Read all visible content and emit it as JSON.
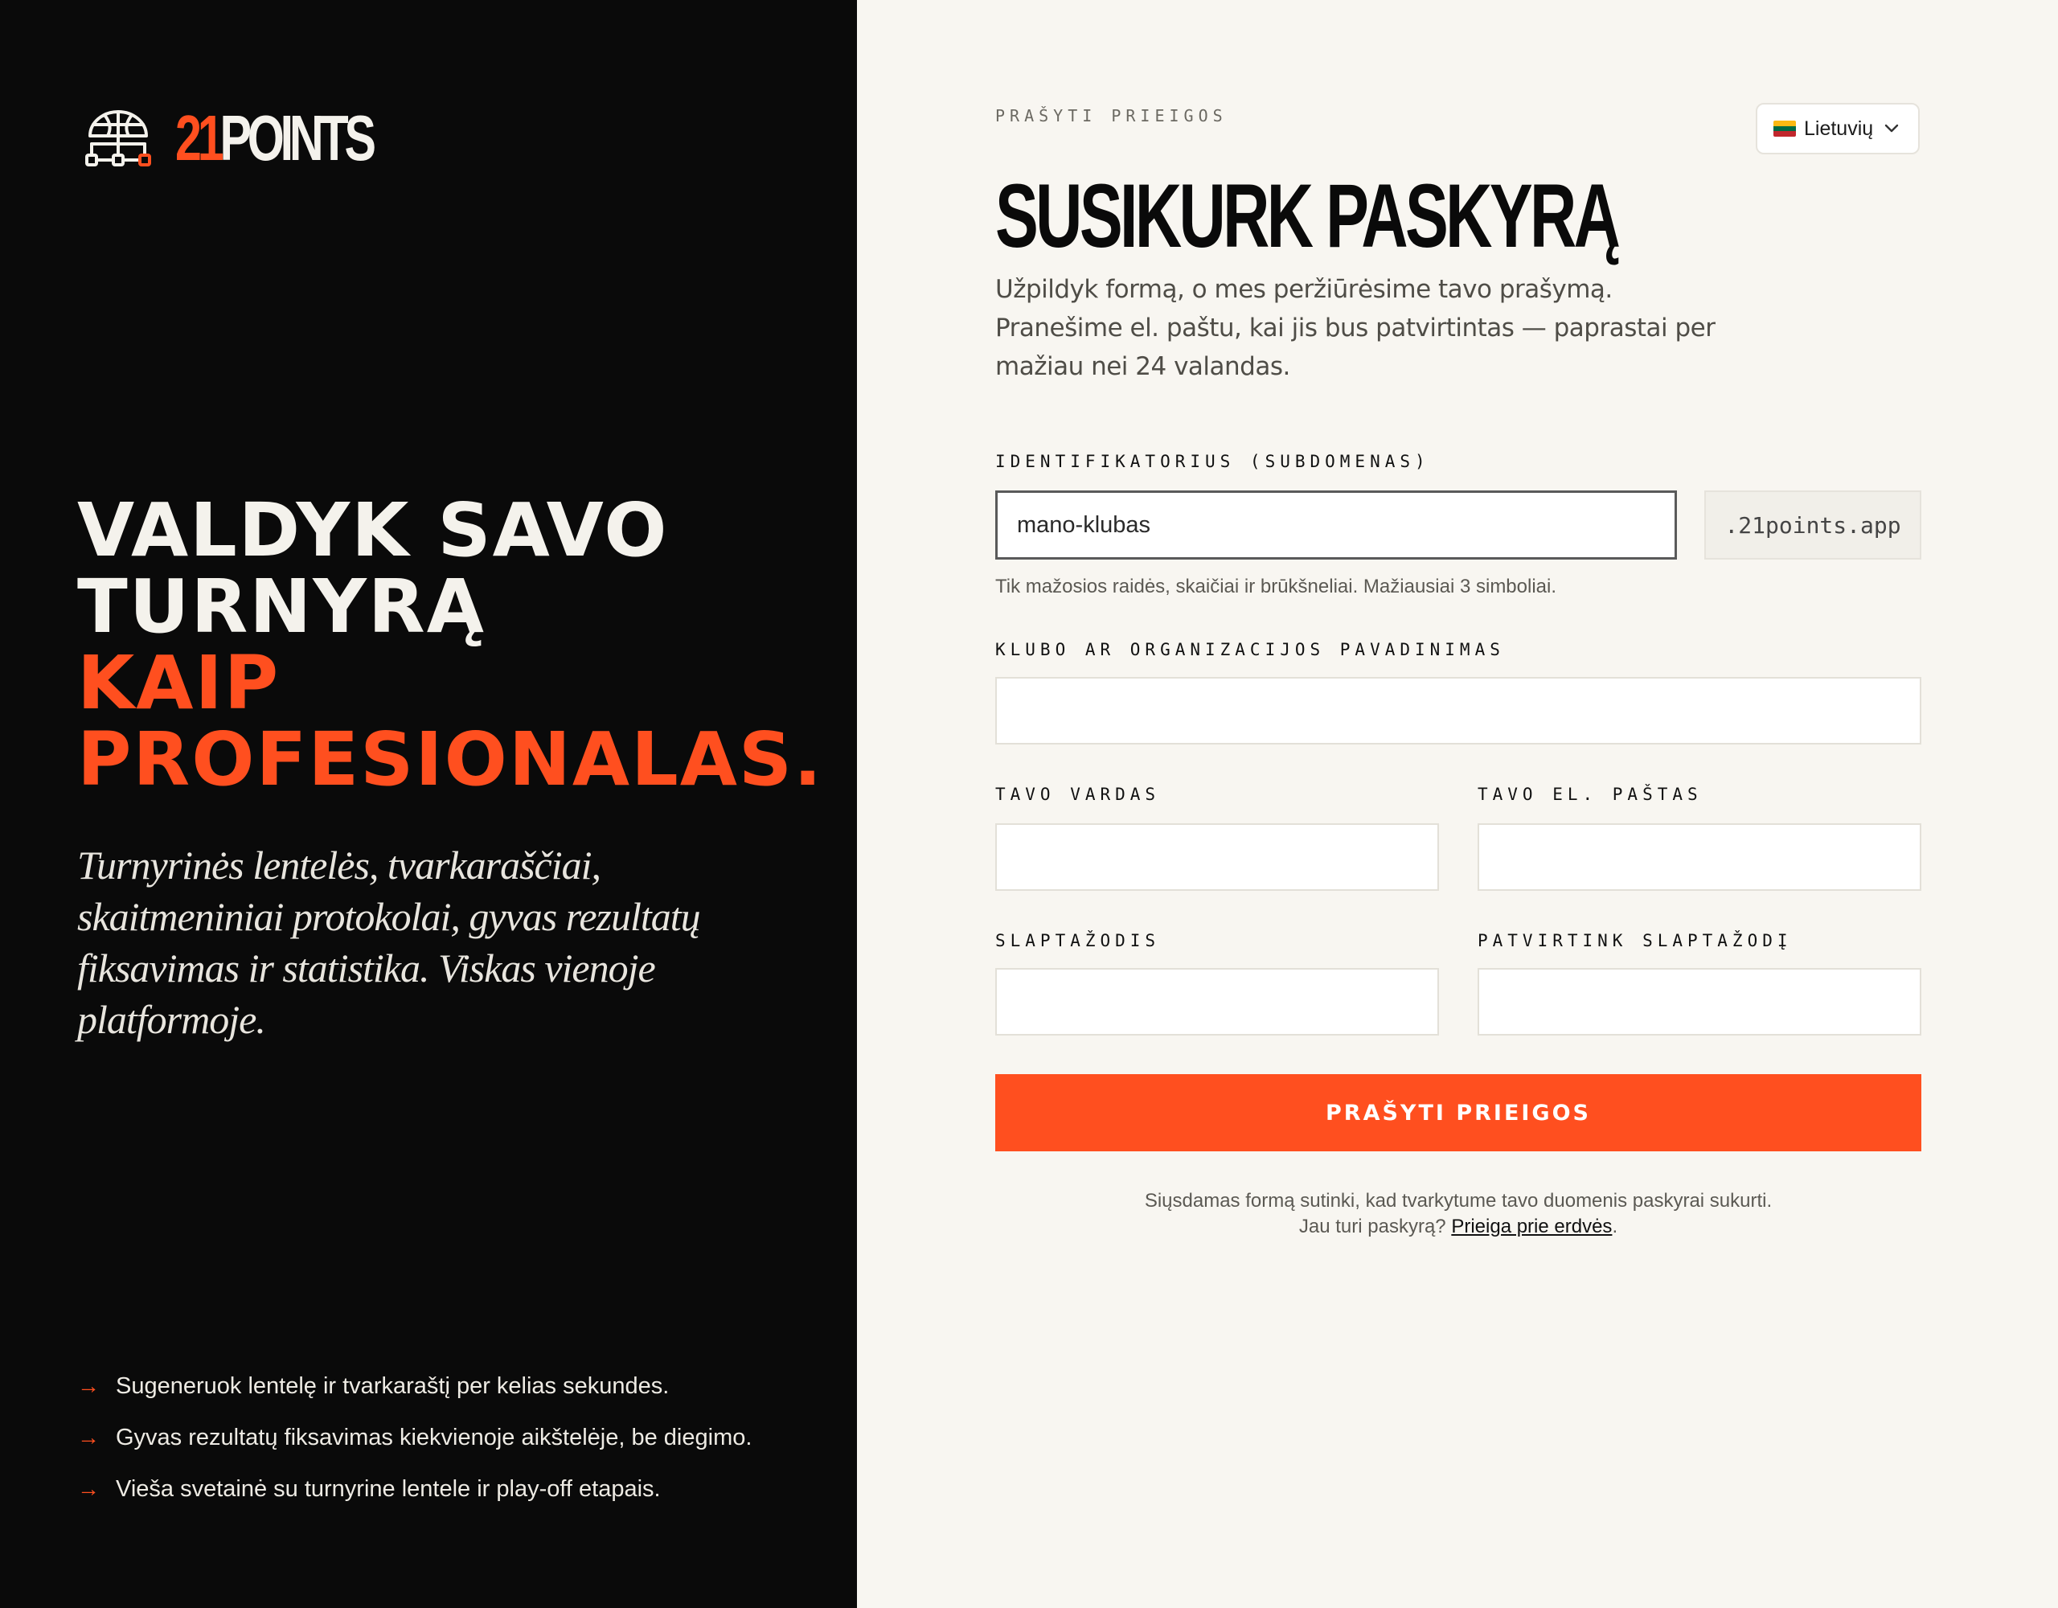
{
  "brand": {
    "logo_icon": "basketball-bracket-icon",
    "name_number": "21",
    "name_rest": "POINTS"
  },
  "hero": {
    "line1": "VALDYK SAVO",
    "line2": "TURNYRĄ",
    "line3": "KAIP",
    "line4": "PROFESIONALAS."
  },
  "lead": {
    "line1": "Turnyrinės lentelės, tvarkaraščiai,",
    "line2": "skaitmeniniai protokolai, gyvas rezultatų",
    "line3": "fiksavimas ir statistika. Viskas vienoje",
    "line4": "platformoje."
  },
  "features": [
    {
      "icon": "arrow-right-icon",
      "arrow": "→",
      "text": "Sugeneruok lentelę ir tvarkaraštį per kelias sekundes."
    },
    {
      "icon": "arrow-right-icon",
      "arrow": "→",
      "text": "Gyvas rezultatų fiksavimas kiekvienoje aikštelėje, be diegimo."
    },
    {
      "icon": "arrow-right-icon",
      "arrow": "→",
      "text": "Vieša svetainė su turnyrine lentele ir play-off etapais."
    }
  ],
  "form": {
    "eyebrow": "PRAŠYTI PRIEIGOS",
    "title": "SUSIKURK PASKYRĄ",
    "subtitle": {
      "line1": "Užpildyk formą, o mes peržiūrėsime tavo prašymą.",
      "line2": "Pranešime el. paštu, kai jis bus patvirtintas — paprastai per",
      "line3": "mažiau nei 24 valandas."
    },
    "language": {
      "selected": "Lietuvių",
      "flag_icon": "lithuania-flag-icon",
      "chevron": "⌄"
    },
    "subdomain": {
      "label": "IDENTIFIKATORIUS (SUBDOMENAS)",
      "value": "mano-klubas",
      "suffix": ".21points.app",
      "hint": "Tik mažosios raidės, skaičiai ir brūkšneliai. Mažiausiai 3 simboliai."
    },
    "club_name": {
      "label": "KLUBO AR ORGANIZACIJOS PAVADINIMAS",
      "value": ""
    },
    "your_name": {
      "label": "TAVO VARDAS",
      "value": ""
    },
    "your_email": {
      "label": "TAVO EL. PAŠTAS",
      "value": ""
    },
    "password": {
      "label": "SLAPTAŽODIS",
      "value": ""
    },
    "confirm_password": {
      "label": "PATVIRTINK SLAPTAŽODĮ",
      "value": ""
    },
    "submit_label": "PRAŠYTI PRIEIGOS",
    "consent_text": "Siųsdamas formą sutinki, kad tvarkytume tavo duomenis paskyrai sukurti.",
    "login_prompt": "Jau turi paskyrą?",
    "login_link": "Prieiga prie erdvės",
    "login_end": "."
  },
  "colors": {
    "accent": "#ff4f1f",
    "dark_panel": "#0a0a0a",
    "light_panel": "#f8f6f1"
  }
}
